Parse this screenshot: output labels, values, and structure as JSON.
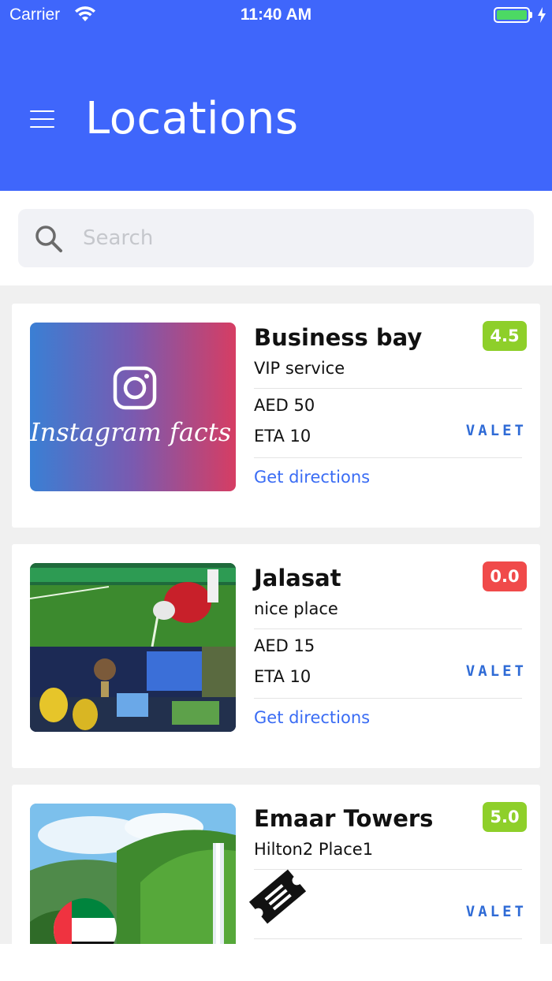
{
  "status_bar": {
    "carrier": "Carrier",
    "time": "11:40 AM",
    "battery_level": 1.0
  },
  "header": {
    "title": "Locations",
    "menu_icon": "hamburger-menu-icon"
  },
  "search": {
    "placeholder": "Search",
    "value": "",
    "icon": "search-icon"
  },
  "colors": {
    "header": "#3f66fb",
    "rating_good": "#8ecf2a",
    "rating_bad": "#f04a4a",
    "link": "#3a6cf4",
    "valet": "#2f6bd6"
  },
  "locations": [
    {
      "name": "Business bay",
      "subtitle": "VIP service",
      "rating": "4.5",
      "price": "AED 50",
      "eta": "ETA 10",
      "service_logo": "VALET",
      "directions_label": "Get directions",
      "image": {
        "caption": "Instagram facts",
        "icon": "instagram-icon"
      }
    },
    {
      "name": "Jalasat",
      "subtitle": "nice place",
      "rating": "0.0",
      "price": "AED 15",
      "eta": "ETA 10",
      "service_logo": "VALET",
      "directions_label": "Get directions",
      "image": {
        "icon": "soccer-photo"
      }
    },
    {
      "name": "Emaar Towers",
      "subtitle": "Hilton2 Place1",
      "rating": "5.0",
      "service_logo": "VALET",
      "image": {
        "icon": "waterfall-photo"
      },
      "badge_icon": "ticket-icon"
    }
  ]
}
